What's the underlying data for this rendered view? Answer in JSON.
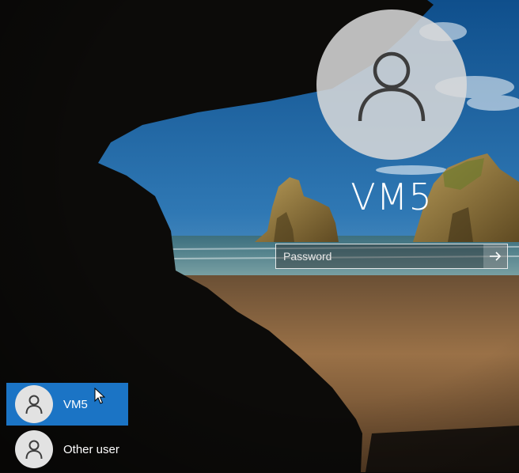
{
  "login": {
    "username": "VM5",
    "password": {
      "value": "",
      "placeholder": "Password"
    },
    "submit_icon": "arrow-right-icon"
  },
  "user_list": [
    {
      "label": "VM5",
      "icon": "user-icon",
      "selected": true
    },
    {
      "label": "Other user",
      "icon": "user-icon",
      "selected": false
    }
  ],
  "colors": {
    "selected_user": "#1b74c5",
    "avatar": "#dadada",
    "avatar_glyph": "#3d3d3d"
  }
}
